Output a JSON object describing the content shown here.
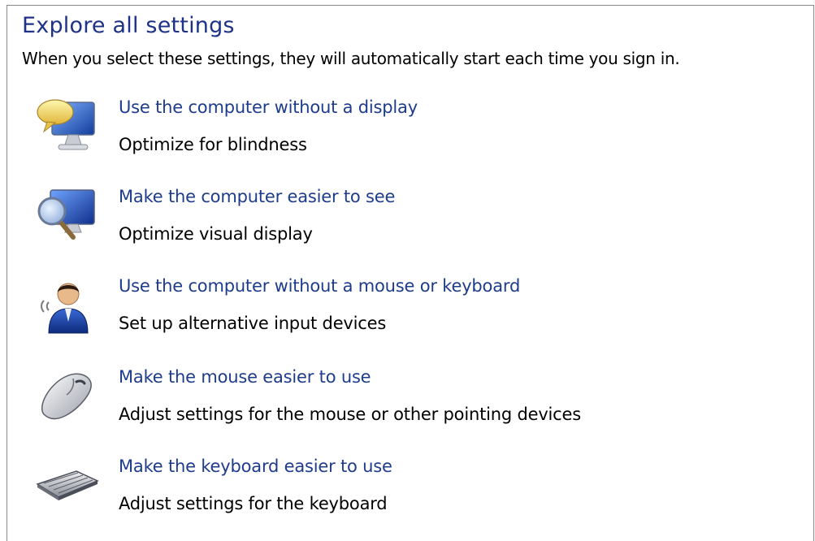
{
  "page": {
    "heading": "Explore all settings",
    "intro": "When you select these settings, they will automatically start each time you sign in."
  },
  "items": [
    {
      "icon": "narrator-monitor-icon",
      "link": "Use the computer without a display",
      "desc": "Optimize for blindness"
    },
    {
      "icon": "magnifier-monitor-icon",
      "link": "Make the computer easier to see",
      "desc": "Optimize visual display"
    },
    {
      "icon": "person-icon",
      "link": "Use the computer without a mouse or keyboard",
      "desc": "Set up alternative input devices"
    },
    {
      "icon": "mouse-icon",
      "link": "Make the mouse easier to use",
      "desc": "Adjust settings for the mouse or other pointing devices"
    },
    {
      "icon": "keyboard-icon",
      "link": "Make the keyboard easier to use",
      "desc": "Adjust settings for the keyboard"
    }
  ]
}
